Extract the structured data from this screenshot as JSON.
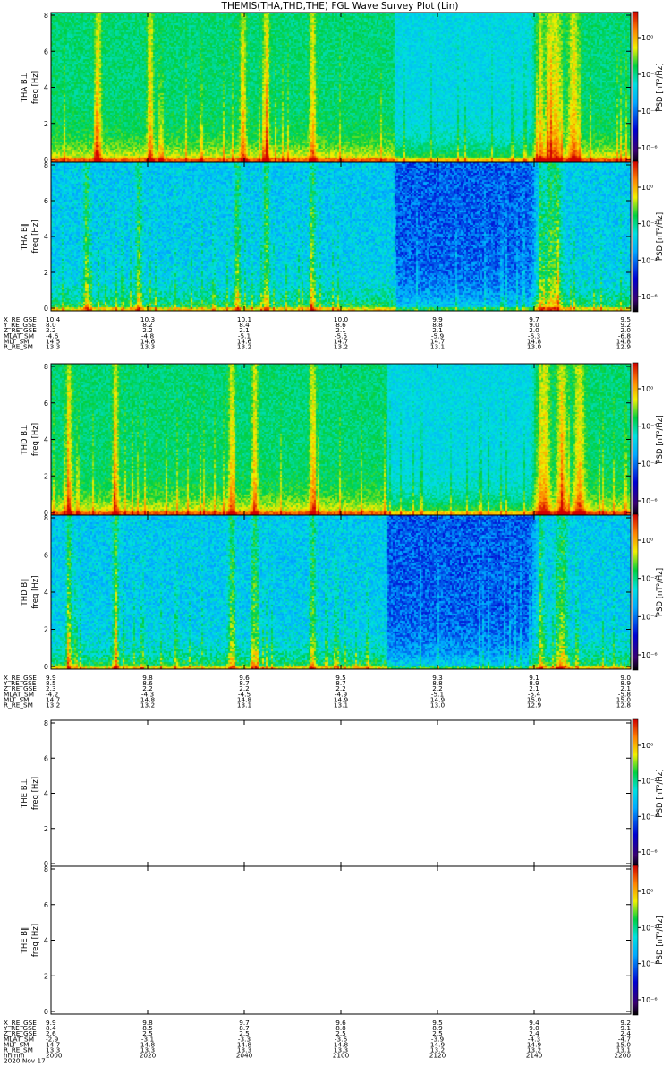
{
  "title": "THEMIS(THA,THD,THE) FGL Wave Survey Plot (Lin)",
  "chart_data": {
    "type": "heatmap",
    "title": "THEMIS(THA,THD,THE) FGL Wave Survey Plot (Lin)",
    "xlabel": "hhmm",
    "x_ticks": [
      "2000",
      "2020",
      "2040",
      "2100",
      "2120",
      "2140",
      "2200"
    ],
    "date_label": "2020 Nov 17",
    "panels": [
      {
        "ylabel": "THA B⊥",
        "ylabel2": "freq [Hz]",
        "yticks": [
          "0",
          "2",
          "4",
          "6",
          "8"
        ],
        "ylim": [
          0,
          8
        ],
        "cbar_label": "PSD [nT²/Hz]",
        "cbar_ticks": [
          "10⁰",
          "10⁻²",
          "10⁻⁴",
          "10⁻⁶"
        ],
        "data_present": true,
        "kind": "perp",
        "bursts": [
          0.08,
          0.17,
          0.33,
          0.37,
          0.45,
          0.84,
          0.86,
          0.87,
          0.9
        ],
        "quiet_range": [
          0.59,
          0.84
        ]
      },
      {
        "ylabel": "THA B∥",
        "ylabel2": "freq [Hz]",
        "yticks": [
          "0",
          "2",
          "4",
          "6",
          "8"
        ],
        "ylim": [
          0,
          8
        ],
        "cbar_label": "PSD [nT²/Hz]",
        "cbar_ticks": [
          "10⁰",
          "10⁻²",
          "10⁻⁴",
          "10⁻⁶"
        ],
        "data_present": true,
        "kind": "para",
        "bursts": [
          0.06,
          0.15,
          0.32,
          0.37,
          0.45,
          0.84,
          0.86,
          0.87
        ],
        "quiet_range": [
          0.59,
          0.84
        ]
      },
      {
        "ylabel": "THD B⊥",
        "ylabel2": "freq [Hz]",
        "yticks": [
          "0",
          "2",
          "4",
          "6",
          "8"
        ],
        "ylim": [
          0,
          8
        ],
        "cbar_label": "PSD [nT²/Hz]",
        "cbar_ticks": [
          "10⁰",
          "10⁻²",
          "10⁻⁴",
          "10⁻⁶"
        ],
        "data_present": true,
        "kind": "perp",
        "bursts": [
          0.03,
          0.11,
          0.31,
          0.35,
          0.45,
          0.84,
          0.85,
          0.88,
          0.91
        ],
        "quiet_range": [
          0.58,
          0.84
        ]
      },
      {
        "ylabel": "THD B∥",
        "ylabel2": "freq [Hz]",
        "yticks": [
          "0",
          "2",
          "4",
          "6",
          "8"
        ],
        "ylim": [
          0,
          8
        ],
        "cbar_label": "PSD [nT²/Hz]",
        "cbar_ticks": [
          "10⁰",
          "10⁻²",
          "10⁻⁴",
          "10⁻⁶"
        ],
        "data_present": true,
        "kind": "para",
        "bursts": [
          0.03,
          0.11,
          0.31,
          0.35,
          0.45,
          0.84,
          0.88
        ],
        "quiet_range": [
          0.58,
          0.84
        ]
      },
      {
        "ylabel": "THE B⊥",
        "ylabel2": "freq [Hz]",
        "yticks": [
          "0",
          "2",
          "4",
          "6",
          "8"
        ],
        "ylim": [
          0,
          8
        ],
        "cbar_label": "PSD [nT²/Hz]",
        "cbar_ticks": [
          "10⁰",
          "10⁻²",
          "10⁻⁴",
          "10⁻⁶"
        ],
        "data_present": false
      },
      {
        "ylabel": "THE B∥",
        "ylabel2": "freq [Hz]",
        "yticks": [
          "0",
          "2",
          "4",
          "6",
          "8"
        ],
        "ylim": [
          0,
          8
        ],
        "cbar_label": "PSD [nT²/Hz]",
        "cbar_ticks": [
          "10⁰",
          "10⁻²",
          "10⁻⁴",
          "10⁻⁶"
        ],
        "data_present": false
      }
    ],
    "ephemeris": [
      {
        "probe": "THA",
        "rows": [
          {
            "label": "X_RE_GSE",
            "values": [
              "10.4",
              "10.3",
              "10.1",
              "10.0",
              "9.9",
              "9.7",
              "9.5"
            ]
          },
          {
            "label": "Y_RE_GSE",
            "values": [
              "8.0",
              "8.2",
              "8.4",
              "8.6",
              "8.8",
              "9.0",
              "9.2"
            ]
          },
          {
            "label": "Z_RE_GSE",
            "values": [
              "2.2",
              "2.2",
              "2.1",
              "2.1",
              "2.1",
              "2.0",
              "2.0"
            ]
          },
          {
            "label": "MLAT_SM",
            "values": [
              "-4.6",
              "-4.8",
              "-5.1",
              "-5.5",
              "-5.9",
              "-6.3",
              "-6.8"
            ]
          },
          {
            "label": "MLT_SM",
            "values": [
              "14.5",
              "14.6",
              "14.6",
              "14.7",
              "14.7",
              "14.8",
              "14.8"
            ]
          },
          {
            "label": "R_RE_SM",
            "values": [
              "13.3",
              "13.3",
              "13.2",
              "13.2",
              "13.1",
              "13.0",
              "12.9"
            ]
          }
        ]
      },
      {
        "probe": "THD",
        "rows": [
          {
            "label": "X_RE_GSE",
            "values": [
              "9.9",
              "9.8",
              "9.6",
              "9.5",
              "9.3",
              "9.1",
              "9.0"
            ]
          },
          {
            "label": "Y_RE_GSE",
            "values": [
              "8.5",
              "8.6",
              "8.7",
              "8.7",
              "8.8",
              "8.9",
              "8.9"
            ]
          },
          {
            "label": "Z_RE_GSE",
            "values": [
              "2.3",
              "2.2",
              "2.2",
              "2.2",
              "2.2",
              "2.1",
              "2.1"
            ]
          },
          {
            "label": "MLAT_SM",
            "values": [
              "-4.2",
              "-4.3",
              "-4.5",
              "-4.9",
              "-5.1",
              "-5.4",
              "-5.8"
            ]
          },
          {
            "label": "MLT_SM",
            "values": [
              "14.7",
              "14.8",
              "14.8",
              "14.9",
              "14.9",
              "15.0",
              "15.0"
            ]
          },
          {
            "label": "R_RE_SM",
            "values": [
              "13.2",
              "13.2",
              "13.1",
              "13.1",
              "13.0",
              "12.9",
              "12.8"
            ]
          }
        ]
      },
      {
        "probe": "THE",
        "rows": [
          {
            "label": "X_RE_GSE",
            "values": [
              "9.9",
              "9.8",
              "9.7",
              "9.6",
              "9.5",
              "9.4",
              "9.2"
            ]
          },
          {
            "label": "Y_RE_GSE",
            "values": [
              "8.4",
              "8.5",
              "8.7",
              "8.8",
              "8.9",
              "9.0",
              "9.1"
            ]
          },
          {
            "label": "Z_RE_GSE",
            "values": [
              "2.6",
              "2.5",
              "2.5",
              "2.5",
              "2.5",
              "2.4",
              "2.4"
            ]
          },
          {
            "label": "MLAT_SM",
            "values": [
              "-2.9",
              "-3.1",
              "-3.3",
              "-3.6",
              "-3.9",
              "-4.3",
              "-4.7"
            ]
          },
          {
            "label": "MLT_SM",
            "values": [
              "14.7",
              "14.8",
              "14.8",
              "14.8",
              "14.9",
              "14.9",
              "15.0"
            ]
          },
          {
            "label": "R_RE_SM",
            "values": [
              "13.3",
              "13.3",
              "13.3",
              "13.3",
              "13.2",
              "13.2",
              "13.1"
            ]
          }
        ]
      }
    ],
    "bottom_rows": [
      {
        "label": "hhmm",
        "values": [
          "2000",
          "2020",
          "2040",
          "2100",
          "2120",
          "2140",
          "2200"
        ]
      },
      {
        "label": "2020 Nov 17",
        "values": []
      }
    ]
  }
}
